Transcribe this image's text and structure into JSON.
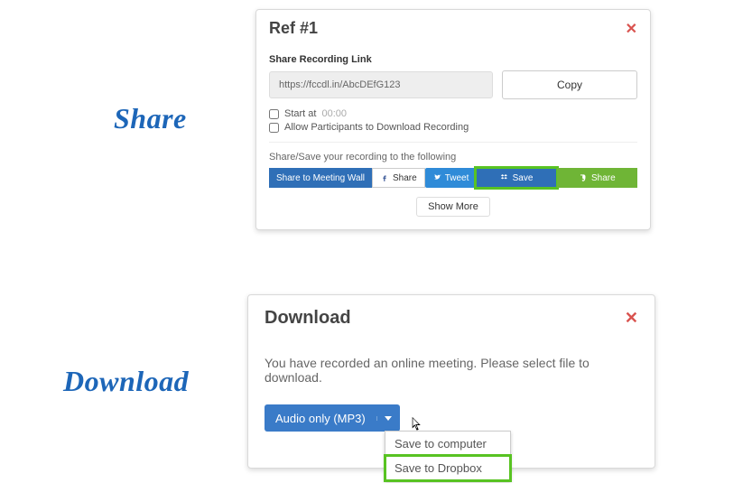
{
  "labels": {
    "share": "Share",
    "download": "Download"
  },
  "share_panel": {
    "title": "Ref #1",
    "close": "✕",
    "section_label": "Share Recording Link",
    "url": "https://fccdl.in/AbcDEfG123",
    "copy": "Copy",
    "start_at_label": "Start at",
    "start_at_value": "00:00",
    "allow_label": "Allow Participants to Download Recording",
    "share_save_label": "Share/Save your recording to the following",
    "meeting_wall": "Share to Meeting Wall",
    "fb": "Share",
    "tw": "Tweet",
    "dropbox_save": "Save",
    "evernote_share": "Share",
    "show_more": "Show More"
  },
  "download_panel": {
    "title": "Download",
    "close": "✕",
    "text": "You have recorded an online meeting. Please select file to download.",
    "dropdown_label": "Audio only (MP3)",
    "menu": {
      "computer": "Save to computer",
      "dropbox": "Save to Dropbox"
    }
  }
}
